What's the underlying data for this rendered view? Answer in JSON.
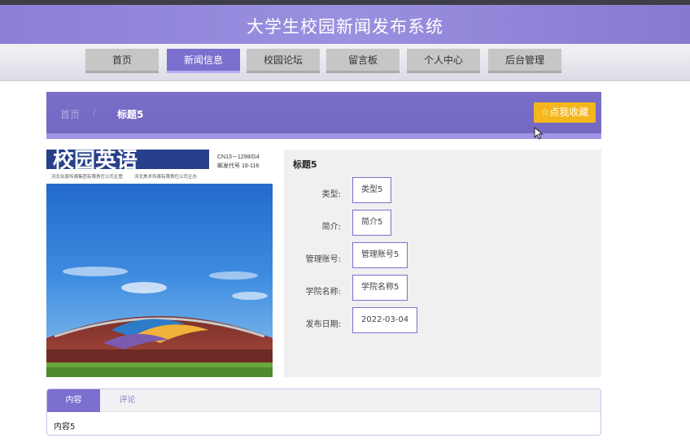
{
  "header": {
    "title": "大学生校园新闻发布系统"
  },
  "nav": {
    "items": [
      {
        "label": "首页"
      },
      {
        "label": "新闻信息",
        "active": true
      },
      {
        "label": "校园论坛"
      },
      {
        "label": "留言板"
      },
      {
        "label": "个人中心"
      },
      {
        "label": "后台管理"
      }
    ]
  },
  "breadcrumb": {
    "home": "首页",
    "separator": "/",
    "current": "标题5"
  },
  "favorite_button": {
    "icon": "star-outline-icon",
    "label": "点我收藏"
  },
  "cover_image": {
    "masthead_text": "校园英语",
    "issn": "CN13－1298/G4",
    "postal_code": "邮发代号 18-116",
    "publisher_left": "河北出版传媒集团有限责任公司主管",
    "publisher_right": "河北美术传媒有限责任公司主办"
  },
  "detail": {
    "title": "标题5",
    "fields": [
      {
        "label": "类型:",
        "value": "类型5"
      },
      {
        "label": "简介:",
        "value": "简介5"
      },
      {
        "label": "管理账号:",
        "value": "管理账号5"
      },
      {
        "label": "学院名称:",
        "value": "学院名称5"
      },
      {
        "label": "发布日期:",
        "value": "2022-03-04"
      }
    ]
  },
  "tabs": {
    "items": [
      {
        "label": "内容",
        "active": true
      },
      {
        "label": "评论"
      }
    ],
    "content": "内容5"
  },
  "colors": {
    "accent": "#7b6fcf",
    "favorite": "#f3b61c",
    "header": "#8b7fd6"
  }
}
